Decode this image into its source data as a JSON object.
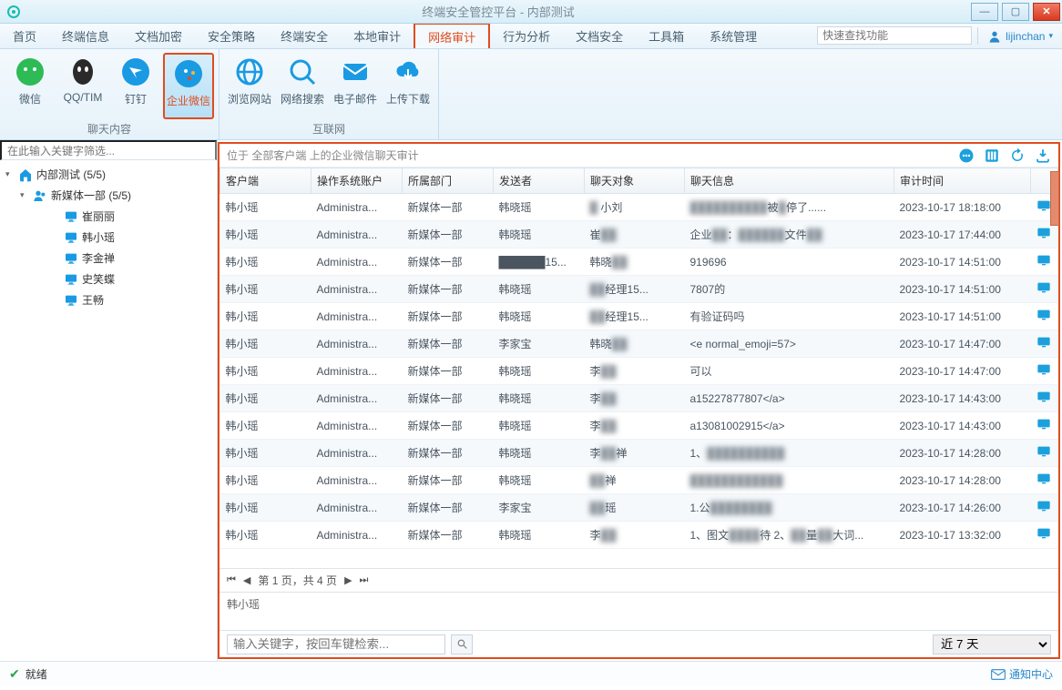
{
  "window": {
    "title": "终端安全管控平台 - 内部测试"
  },
  "menubar": {
    "items": [
      "首页",
      "终端信息",
      "文档加密",
      "安全策略",
      "终端安全",
      "本地审计",
      "网络审计",
      "行为分析",
      "文档安全",
      "工具箱",
      "系统管理"
    ],
    "active_index": 6,
    "search_placeholder": "快速查找功能",
    "user": "lijinchan"
  },
  "ribbon": {
    "groups": [
      {
        "label": "聊天内容",
        "items": [
          {
            "label": "微信",
            "icon": "wechat",
            "color": "#2dbb55"
          },
          {
            "label": "QQ/TIM",
            "icon": "qq",
            "color": "#2a2a2a"
          },
          {
            "label": "钉钉",
            "icon": "dingtalk",
            "color": "#1a9ae2"
          },
          {
            "label": "企业微信",
            "icon": "wecom",
            "color": "#1a9ae2",
            "active": true
          }
        ]
      },
      {
        "label": "互联网",
        "items": [
          {
            "label": "浏览网站",
            "icon": "globe",
            "color": "#1a9ae2"
          },
          {
            "label": "网络搜索",
            "icon": "search-globe",
            "color": "#1a9ae2"
          },
          {
            "label": "电子邮件",
            "icon": "mail",
            "color": "#1a9ae2"
          },
          {
            "label": "上传下载",
            "icon": "cloud",
            "color": "#1a9ae2"
          }
        ]
      }
    ]
  },
  "sidebar": {
    "filter_placeholder": "在此输入关键字筛选...",
    "tree": {
      "root": {
        "label": "内部测试 (5/5)",
        "expanded": true
      },
      "group": {
        "label": "新媒体一部 (5/5)",
        "expanded": true
      },
      "clients": [
        "崔丽丽",
        "韩小瑶",
        "李金禅",
        "史笑蝶",
        "王畅"
      ]
    }
  },
  "content": {
    "header_text": "位于 全部客户端 上的企业微信聊天审计",
    "columns": [
      "客户端",
      "操作系统账户",
      "所属部门",
      "发送者",
      "聊天对象",
      "聊天信息",
      "审计时间",
      ""
    ],
    "rows": [
      {
        "client": "韩小瑶",
        "os": "Administra...",
        "dept": "新媒体一部",
        "sender": "韩晓瑶",
        "target": "█  小刘",
        "msg": "██████████被█停了......",
        "time": "2023-10-17 18:18:00"
      },
      {
        "client": "韩小瑶",
        "os": "Administra...",
        "dept": "新媒体一部",
        "sender": "韩晓瑶",
        "target": "崔██",
        "msg": "企业██：██████文件██",
        "time": "2023-10-17 17:44:00"
      },
      {
        "client": "韩小瑶",
        "os": "Administra...",
        "dept": "新媒体一部",
        "sender": "██████15...",
        "target": "韩晓██",
        "msg": "919696",
        "time": "2023-10-17 14:51:00"
      },
      {
        "client": "韩小瑶",
        "os": "Administra...",
        "dept": "新媒体一部",
        "sender": "韩晓瑶",
        "target": "██经理15...",
        "msg": "7807的",
        "time": "2023-10-17 14:51:00"
      },
      {
        "client": "韩小瑶",
        "os": "Administra...",
        "dept": "新媒体一部",
        "sender": "韩晓瑶",
        "target": "██经理15...",
        "msg": "有验证码吗",
        "time": "2023-10-17 14:51:00"
      },
      {
        "client": "韩小瑶",
        "os": "Administra...",
        "dept": "新媒体一部",
        "sender": "李家宝",
        "target": "韩晓██",
        "msg": "<e normal_emoji=57>",
        "time": "2023-10-17 14:47:00"
      },
      {
        "client": "韩小瑶",
        "os": "Administra...",
        "dept": "新媒体一部",
        "sender": "韩晓瑶",
        "target": "李██",
        "msg": "可以",
        "time": "2023-10-17 14:47:00"
      },
      {
        "client": "韩小瑶",
        "os": "Administra...",
        "dept": "新媒体一部",
        "sender": "韩晓瑶",
        "target": "李██",
        "msg": "a15227877807</a>",
        "time": "2023-10-17 14:43:00"
      },
      {
        "client": "韩小瑶",
        "os": "Administra...",
        "dept": "新媒体一部",
        "sender": "韩晓瑶",
        "target": "李██",
        "msg": "a13081002915</a>",
        "time": "2023-10-17 14:43:00"
      },
      {
        "client": "韩小瑶",
        "os": "Administra...",
        "dept": "新媒体一部",
        "sender": "韩晓瑶",
        "target": "李██禅",
        "msg": "1、██████████",
        "time": "2023-10-17 14:28:00"
      },
      {
        "client": "韩小瑶",
        "os": "Administra...",
        "dept": "新媒体一部",
        "sender": "韩晓瑶",
        "target": "██禅",
        "msg": "████████████",
        "time": "2023-10-17 14:28:00"
      },
      {
        "client": "韩小瑶",
        "os": "Administra...",
        "dept": "新媒体一部",
        "sender": "李家宝",
        "target": "██瑶",
        "msg": "1.公████████",
        "time": "2023-10-17 14:26:00"
      },
      {
        "client": "韩小瑶",
        "os": "Administra...",
        "dept": "新媒体一部",
        "sender": "韩晓瑶",
        "target": "李██",
        "msg": "1、图文████待  2、██量██大词...",
        "time": "2023-10-17 13:32:00"
      }
    ],
    "pager": {
      "text": "第 1 页，共 4 页"
    },
    "detail": "韩小瑶",
    "search_placeholder": "输入关键字，按回车键检索...",
    "range_selected": "近 7 天"
  },
  "status": {
    "ready": "就绪",
    "notif": "通知中心"
  }
}
